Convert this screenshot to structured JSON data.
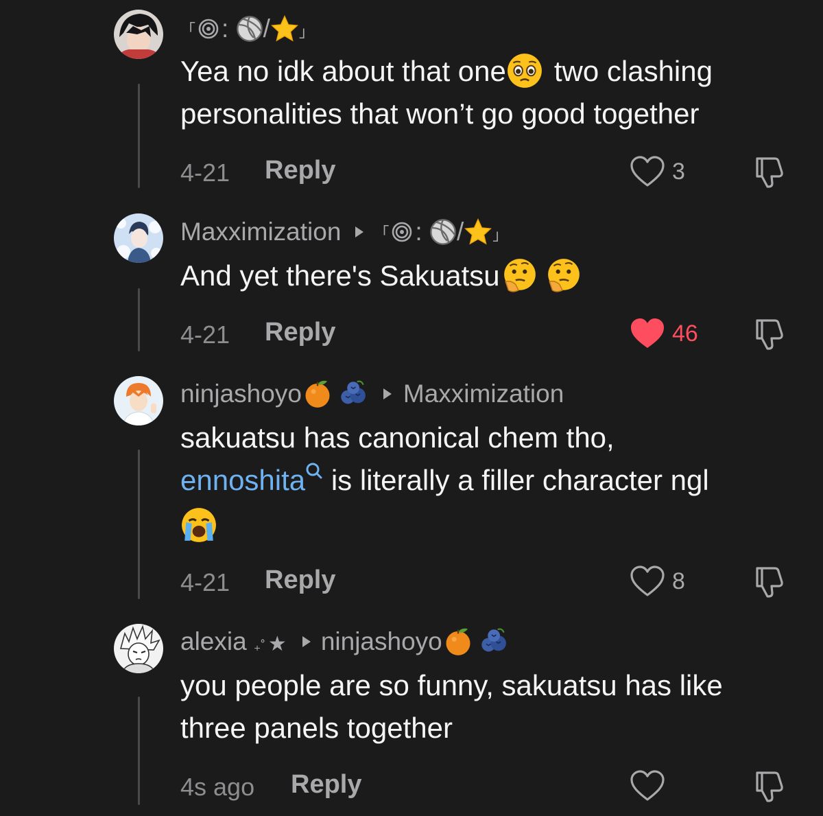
{
  "comments": [
    {
      "username": "",
      "reply_to": "「🌀: 🏐/⭐」",
      "text_lines": [
        "Yea no idk about that one 🥺 two clashing",
        "personalities that won’t go good together"
      ],
      "date": "4-21",
      "reply_label": "Reply",
      "likes": "3",
      "liked": false
    },
    {
      "username": "Maxximization",
      "reply_to": "「🌀: 🏐/⭐」",
      "text_lines": [
        "And yet there's Sakuatsu 🤔 🤔"
      ],
      "date": "4-21",
      "reply_label": "Reply",
      "likes": "46",
      "liked": true
    },
    {
      "username": "ninjashoyo 🍊 🫐",
      "reply_to": "Maxximization",
      "text_lines": [
        "sakuatsu has canonical chem tho,",
        "is literally a filler character ngl",
        "😭"
      ],
      "link_text": "ennoshita",
      "date": "4-21",
      "reply_label": "Reply",
      "likes": "8",
      "liked": false
    },
    {
      "username": "alexia ₊˚★",
      "reply_to": "ninjashoyo 🍊 🫐",
      "text_lines": [
        "you people are so funny, sakuatsu has like",
        "three panels together"
      ],
      "date": "4s ago",
      "reply_label": "Reply",
      "likes": "",
      "liked": false
    }
  ],
  "colors": {
    "background": "#1b1b1c",
    "liked_heart": "#fe4d5f",
    "mention_link": "#6fb2f2",
    "muted_text": "#a9a9ab"
  },
  "icons": [
    "heart-outline-icon",
    "heart-filled-icon",
    "dislike-icon",
    "search-icon",
    "play-arrow-icon"
  ]
}
